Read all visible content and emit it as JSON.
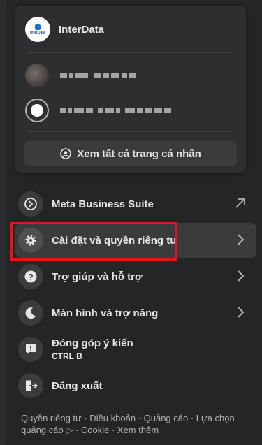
{
  "colors": {
    "background": "#242526",
    "card": "#2d2e2f",
    "button": "#3a3b3c",
    "text": "#e4e6eb",
    "secondary_text": "#b0b3b8",
    "highlight": "#e3141e"
  },
  "profile": {
    "page_name": "InterData",
    "logo_text": "InterData",
    "see_all_label": "Xem tất cả trang cá nhân",
    "see_all_icon": "user-circle-icon"
  },
  "menu": {
    "items": [
      {
        "label": "Meta Business Suite",
        "icon": "meta-business-icon",
        "trailing": "external-arrow-icon"
      },
      {
        "label": "Cài đặt và quyền riêng tư",
        "icon": "gear-icon",
        "trailing": "chevron-right-icon"
      },
      {
        "label": "Trợ giúp và hỗ trợ",
        "icon": "help-icon",
        "trailing": "chevron-right-icon"
      },
      {
        "label": "Màn hình và trợ năng",
        "icon": "moon-icon",
        "trailing": "chevron-right-icon"
      },
      {
        "label": "Đóng góp ý kiến",
        "sublabel": "CTRL B",
        "icon": "feedback-icon"
      },
      {
        "label": "Đăng xuất",
        "icon": "logout-icon"
      }
    ]
  },
  "footer": {
    "text": "Quyền riêng tư · Điều khoản · Quảng cáo · Lựa chọn quảng cáo ▷ · Cookie · Xem thêm"
  }
}
